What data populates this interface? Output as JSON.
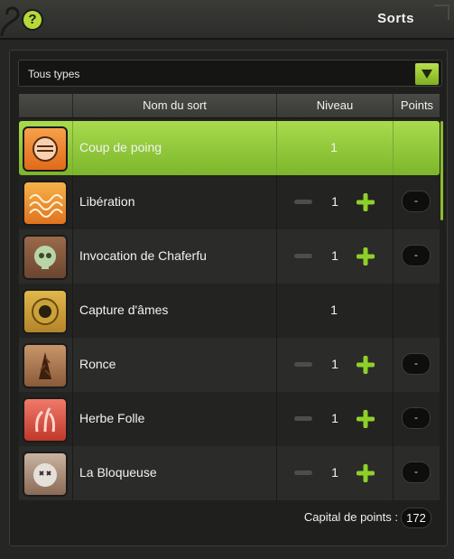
{
  "window": {
    "title": "Sorts",
    "help_label": "?"
  },
  "filter": {
    "selected": "Tous types"
  },
  "table": {
    "headers": {
      "name": "Nom du sort",
      "level": "Niveau",
      "points": "Points"
    },
    "rows": [
      {
        "name": "Coup de poing",
        "level": "1",
        "points": "",
        "icon": "fist-icon",
        "editable": false,
        "selected": true
      },
      {
        "name": "Libération",
        "level": "1",
        "points": "-",
        "icon": "wave-pattern-icon",
        "editable": true,
        "selected": false
      },
      {
        "name": "Invocation de Chaferfu",
        "level": "1",
        "points": "-",
        "icon": "skull-icon",
        "editable": true,
        "selected": false
      },
      {
        "name": "Capture d'âmes",
        "level": "1",
        "points": "",
        "icon": "soul-capture-icon",
        "editable": false,
        "selected": false
      },
      {
        "name": "Ronce",
        "level": "1",
        "points": "-",
        "icon": "bramble-icon",
        "editable": true,
        "selected": false
      },
      {
        "name": "Herbe Folle",
        "level": "1",
        "points": "-",
        "icon": "wild-grass-icon",
        "editable": true,
        "selected": false
      },
      {
        "name": "La Bloqueuse",
        "level": "1",
        "points": "-",
        "icon": "blocker-icon",
        "editable": true,
        "selected": false
      }
    ]
  },
  "footer": {
    "capital_label": "Capital de points :",
    "capital_value": "172"
  },
  "colors": {
    "accent": "#9dd13f",
    "background": "#262624"
  }
}
